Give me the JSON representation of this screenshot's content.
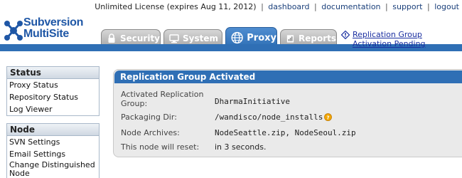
{
  "header": {
    "license_text": "Unlimited License (expires Aug 11, 2012)",
    "links": [
      "dashboard",
      "documentation",
      "support",
      "logout"
    ],
    "separator": "|"
  },
  "logo": {
    "line1": "Subversion",
    "line2": "MultiSite"
  },
  "tabs": [
    {
      "label": "Security",
      "icon": "lock-icon"
    },
    {
      "label": "System",
      "icon": "monitor-icon"
    },
    {
      "label": "Proxy",
      "icon": "globe-icon",
      "active": true
    },
    {
      "label": "Reports",
      "icon": "report-icon"
    }
  ],
  "notice": {
    "text": "Replication Group Activation Pending",
    "icon": "diamond-alert-icon"
  },
  "sidebar": {
    "sections": [
      {
        "title": "Status",
        "items": [
          "Proxy Status",
          "Repository Status",
          "Log Viewer"
        ]
      },
      {
        "title": "Node",
        "items": [
          "SVN Settings",
          "Email Settings",
          "Change Distinguished Node"
        ]
      }
    ]
  },
  "panel": {
    "title": "Replication Group Activated",
    "rows": [
      {
        "label": "Activated Replication Group:",
        "value": "DharmaInitiative"
      },
      {
        "label": "Packaging Dir:",
        "value": "/wandisco/node_installs",
        "help_icon": "question-icon"
      },
      {
        "label": "Node Archives:",
        "value": "NodeSeattle.zip, NodeSeoul.zip"
      },
      {
        "label": "This node will reset:",
        "value": "in 3 seconds."
      }
    ]
  },
  "colors": {
    "brand_blue": "#2f6fb5",
    "logo_blue": "#1f57a6",
    "help_orange": "#f0a500"
  }
}
